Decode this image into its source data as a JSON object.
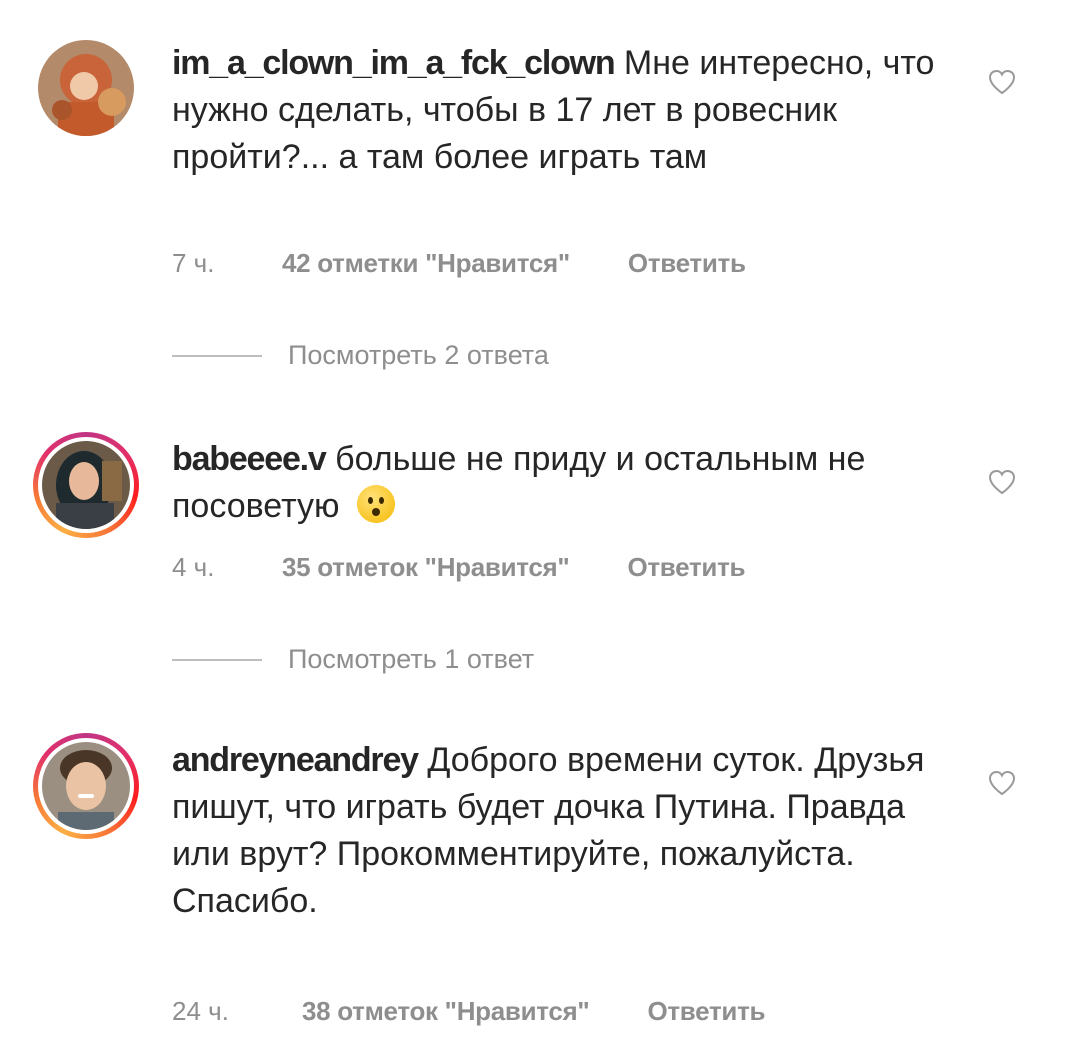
{
  "comments": [
    {
      "username": "im_a_clown_im_a_fck_clown",
      "text": "Мне интересно, что нужно сделать, чтобы в 17 лет в ровесник пройти?... а там более играть там",
      "time": "7 ч.",
      "likes": "42 отметки \"Нравится\"",
      "reply": "Ответить",
      "view_replies": "Посмотреть 2 ответа",
      "avatar_icon": "avatar-photo"
    },
    {
      "username": "babeeee.v",
      "text": "больше не приду и остальным не посоветую",
      "emoji": "hushed-face-emoji",
      "time": "4 ч.",
      "likes": "35 отметок \"Нравится\"",
      "reply": "Ответить",
      "view_replies": "Посмотреть 1 ответ",
      "avatar_icon": "avatar-photo-story-ring"
    },
    {
      "username": "andreyneandrey",
      "text": "Доброго времени суток. Друзья пишут, что играть будет дочка Путина. Правда или врут? Прокомментируйте, пожалуйста. Спасибо.",
      "time": "24 ч.",
      "likes": "38 отметок \"Нравится\"",
      "reply": "Ответить",
      "avatar_icon": "avatar-photo-story-ring"
    }
  ],
  "colors": {
    "text": "#262626",
    "secondary": "#8e8e8e",
    "background": "#ffffff"
  },
  "icons": {
    "like": "heart-outline-icon"
  }
}
